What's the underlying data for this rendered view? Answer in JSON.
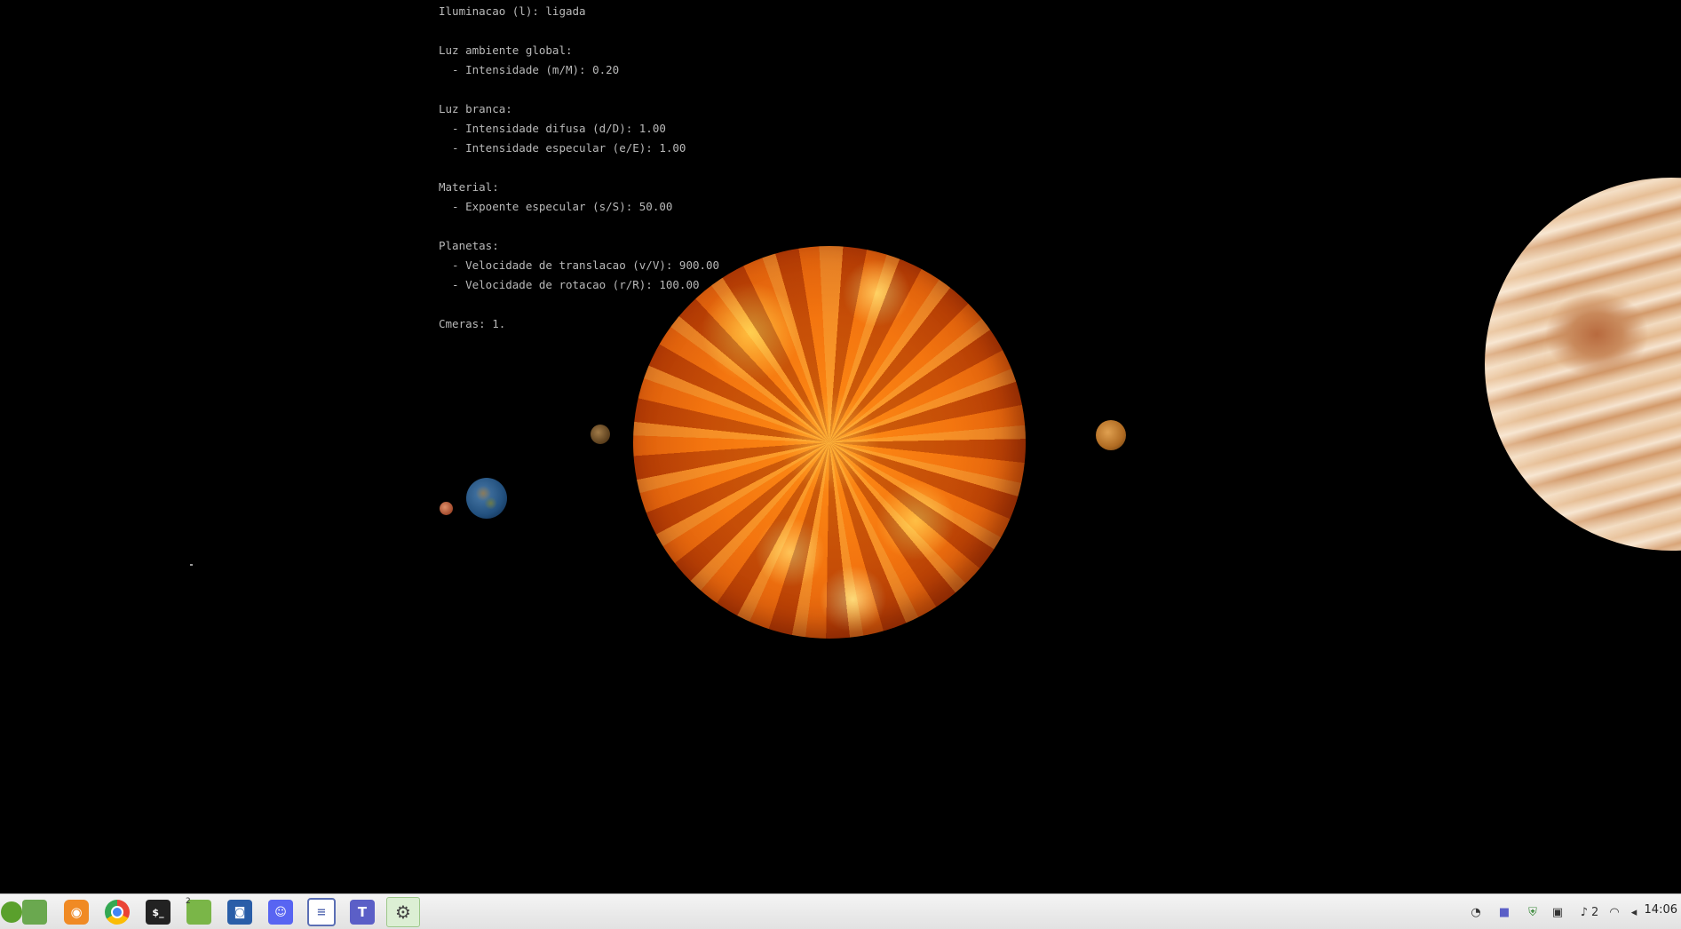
{
  "hud": {
    "lines": [
      "Iluminacao (l): ligada",
      "",
      "Luz ambiente global:",
      "  - Intensidade (m/M): 0.20",
      "",
      "Luz branca:",
      "  - Intensidade difusa (d/D): 1.00",
      "  - Intensidade especular (e/E): 1.00",
      "",
      "Material:",
      "  - Expoente especular (s/S): 50.00",
      "",
      "Planetas:",
      "  - Velocidade de translacao (v/V): 900.00",
      "  - Velocidade de rotacao (r/R): 100.00",
      "",
      "Cmeras: 1."
    ]
  },
  "scene": {
    "bodies": [
      {
        "name": "sun",
        "color": "#f06a0a"
      },
      {
        "name": "jupiter",
        "color": "#e9c9a4"
      },
      {
        "name": "earth",
        "color": "#22507e"
      },
      {
        "name": "mars",
        "color": "#a24a2c"
      }
    ]
  },
  "taskbar": {
    "apps": [
      {
        "name": "mint-menu-icon",
        "color": "#5aa02c"
      },
      {
        "name": "files-icon",
        "color": "#6aa84f"
      },
      {
        "name": "firefox-icon",
        "color": "#f08a24"
      },
      {
        "name": "chrome-icon",
        "color": "#34a853"
      },
      {
        "name": "terminal-icon",
        "color": "#222222"
      },
      {
        "name": "folder-icon",
        "color": "#7ab648",
        "badge": "2"
      },
      {
        "name": "screenshot-icon",
        "color": "#2a5ea8"
      },
      {
        "name": "discord-icon",
        "color": "#5865f2"
      },
      {
        "name": "text-editor-icon",
        "color": "#5b6fb5"
      },
      {
        "name": "teams-icon",
        "color": "#5b5fc7"
      },
      {
        "name": "settings-icon",
        "color": "#444444"
      }
    ],
    "tray": {
      "notifications_count": "2",
      "clock": "14:06"
    }
  }
}
